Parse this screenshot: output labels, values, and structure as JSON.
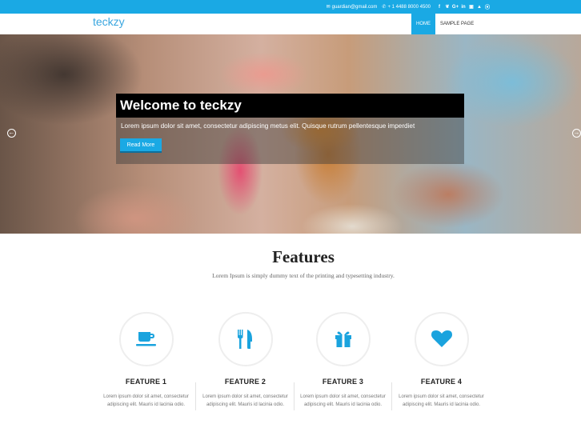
{
  "topbar": {
    "email": "guardian@gmail.com",
    "phone": "+ 1 4488 8000 4500",
    "social_icons": [
      "facebook-icon",
      "twitter-icon",
      "google-plus-icon",
      "linkedin-icon",
      "flickr-icon",
      "youtube-icon",
      "rss-icon"
    ],
    "social_glyphs": [
      "f",
      "❦",
      "G+",
      "in",
      "▣",
      "▲",
      "⦿"
    ]
  },
  "header": {
    "logo": "teckzy",
    "nav": [
      {
        "label": "HOME",
        "active": true
      },
      {
        "label": "SAMPLE PAGE",
        "active": false
      }
    ]
  },
  "hero": {
    "title": "Welcome to teckzy",
    "text": "Lorem ipsum dolor sit amet, consectetur adipiscing metus elit. Quisque rutrum pellentesque imperdiet",
    "button": "Read More",
    "prev_glyph": "←",
    "next_glyph": "→"
  },
  "features": {
    "title": "Features",
    "subtitle": "Lorem Ipsum is simply dummy text of the printing and typesetting industry.",
    "accent": "#1aa3de",
    "items": [
      {
        "icon": "coffee-cup-icon",
        "title": "FEATURE 1",
        "text": "Lorem ipsum dolor sit amet, consectetur adipiscing elit. Mauris id lacinia odio."
      },
      {
        "icon": "cutlery-icon",
        "title": "FEATURE 2",
        "text": "Lorem ipsum dolor sit amet, consectetur adipiscing elit. Mauris id lacinia odio."
      },
      {
        "icon": "gift-icon",
        "title": "FEATURE 3",
        "text": "Lorem ipsum dolor sit amet, consectetur adipiscing elit. Mauris id lacinia odio."
      },
      {
        "icon": "heart-icon",
        "title": "FEATURE 4",
        "text": "Lorem ipsum dolor sit amet, consectetur adipiscing elit. Mauris id lacinia odio."
      }
    ]
  }
}
